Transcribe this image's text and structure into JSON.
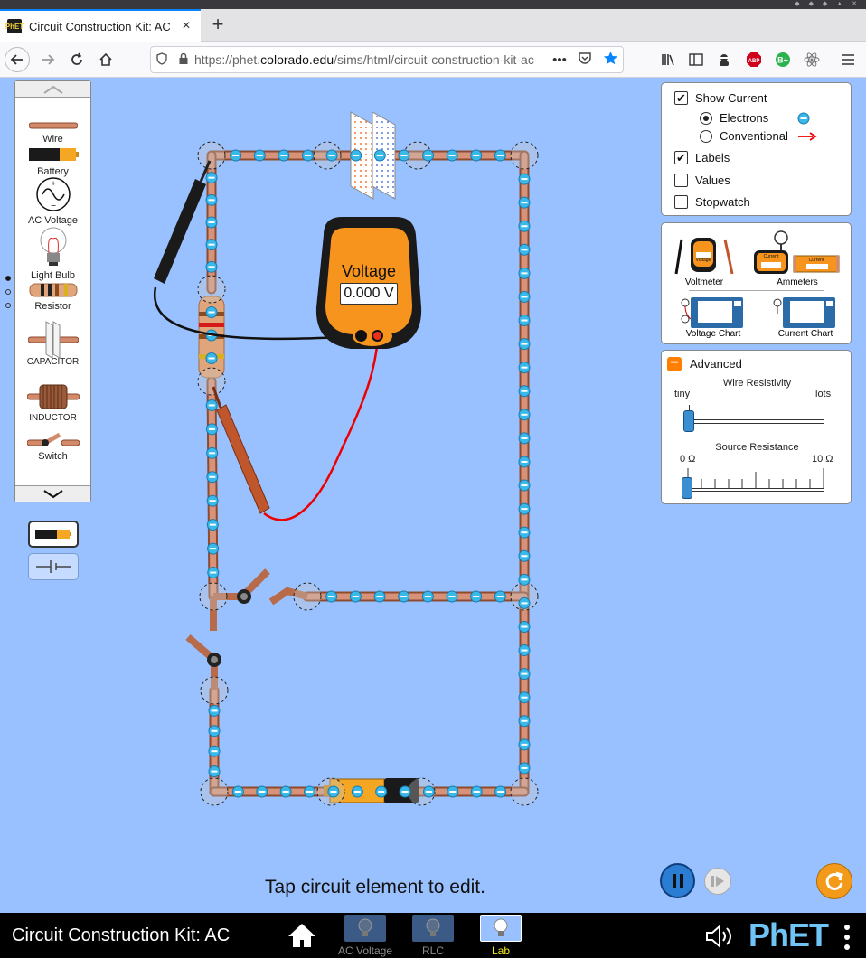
{
  "browser": {
    "tab_title": "Circuit Construction Kit: AC",
    "tab_close": "×",
    "new_tab": "+",
    "url_prefix": "https://phet.",
    "url_domain": "colorado.edu",
    "url_path": "/sims/html/circuit-construction-kit-ac",
    "url_more": "•••",
    "favicon_text": "PhET"
  },
  "toolbox": {
    "items": [
      {
        "label": "Wire"
      },
      {
        "label": "Battery"
      },
      {
        "label": "AC Voltage"
      },
      {
        "label": "Light Bulb"
      },
      {
        "label": "Resistor"
      },
      {
        "label": "CAPACITOR"
      },
      {
        "label": "INDUCTOR"
      },
      {
        "label": "Switch"
      }
    ],
    "up_arrow": "up-chevron-icon",
    "down_arrow": "down-chevron-icon"
  },
  "display_panel": {
    "show_current": {
      "label": "Show Current",
      "checked": true
    },
    "electrons": {
      "label": "Electrons",
      "selected": true
    },
    "conventional": {
      "label": "Conventional",
      "selected": false
    },
    "labels": {
      "label": "Labels",
      "checked": true
    },
    "values": {
      "label": "Values",
      "checked": false
    },
    "stopwatch": {
      "label": "Stopwatch",
      "checked": false
    }
  },
  "sensors_panel": {
    "voltmeter": "Voltmeter",
    "ammeters": "Ammeters",
    "voltage_chart": "Voltage Chart",
    "current_chart": "Current Chart",
    "mini_voltage": "Voltage",
    "mini_current": "Current",
    "mini_q": "?"
  },
  "advanced_panel": {
    "title": "Advanced",
    "toggle": "−",
    "wire_resistivity": {
      "label": "Wire Resistivity",
      "min_label": "tiny",
      "max_label": "lots",
      "level": 0
    },
    "source_resistance": {
      "label": "Source Resistance",
      "min_label": "0 Ω",
      "max_label": "10 Ω",
      "level": 0
    }
  },
  "voltmeter": {
    "title": "Voltage",
    "reading": "0.000 V"
  },
  "status_text": "Tap circuit element to edit.",
  "bottom_bar": {
    "sim_title": "Circuit Construction Kit: AC",
    "screens": [
      {
        "label": "AC Voltage",
        "active": false
      },
      {
        "label": "RLC",
        "active": false
      },
      {
        "label": "Lab",
        "active": true
      }
    ],
    "brand": "PhET",
    "colors": {
      "active_screen": "#f2e916",
      "inactive_screen": "#8e8e8e"
    }
  },
  "colors": {
    "play_area": "#99c1ff",
    "accent": "#0a84ff",
    "reset": "#f39a1a",
    "meter_body": "#f7941d",
    "wire": "#cf8564"
  }
}
